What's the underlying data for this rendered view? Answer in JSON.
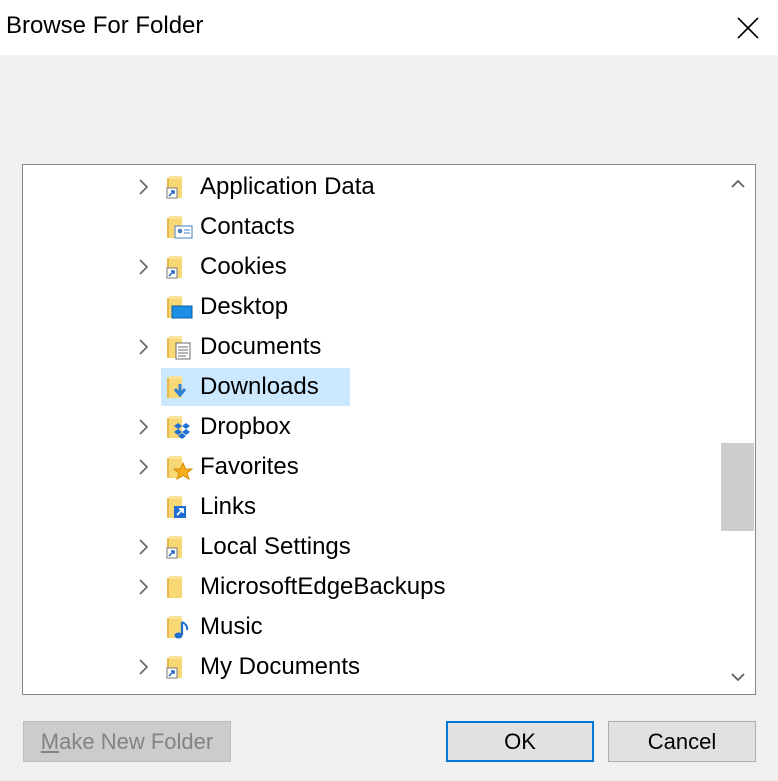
{
  "dialog": {
    "title": "Browse For Folder"
  },
  "tree": {
    "items": [
      {
        "label": "Application Data",
        "expandable": true,
        "icon": "shortcut-folder-icon"
      },
      {
        "label": "Contacts",
        "expandable": false,
        "icon": "contacts-folder-icon"
      },
      {
        "label": "Cookies",
        "expandable": true,
        "icon": "shortcut-folder-icon"
      },
      {
        "label": "Desktop",
        "expandable": false,
        "icon": "desktop-folder-icon"
      },
      {
        "label": "Documents",
        "expandable": true,
        "icon": "documents-folder-icon"
      },
      {
        "label": "Downloads",
        "expandable": false,
        "icon": "downloads-folder-icon",
        "selected": true
      },
      {
        "label": "Dropbox",
        "expandable": true,
        "icon": "dropbox-folder-icon"
      },
      {
        "label": "Favorites",
        "expandable": true,
        "icon": "favorites-folder-icon"
      },
      {
        "label": "Links",
        "expandable": false,
        "icon": "links-folder-icon"
      },
      {
        "label": "Local Settings",
        "expandable": true,
        "icon": "shortcut-folder-icon"
      },
      {
        "label": "MicrosoftEdgeBackups",
        "expandable": true,
        "icon": "folder-icon"
      },
      {
        "label": "Music",
        "expandable": false,
        "icon": "music-folder-icon"
      },
      {
        "label": "My Documents",
        "expandable": true,
        "icon": "shortcut-folder-icon"
      }
    ]
  },
  "buttons": {
    "make_new_folder_mnemonic": "M",
    "make_new_folder_rest": "ake New Folder",
    "ok": "OK",
    "cancel": "Cancel"
  },
  "colors": {
    "selection": "#cce8ff",
    "folder_yellow": "#f8d775",
    "accent": "#0078d7"
  }
}
